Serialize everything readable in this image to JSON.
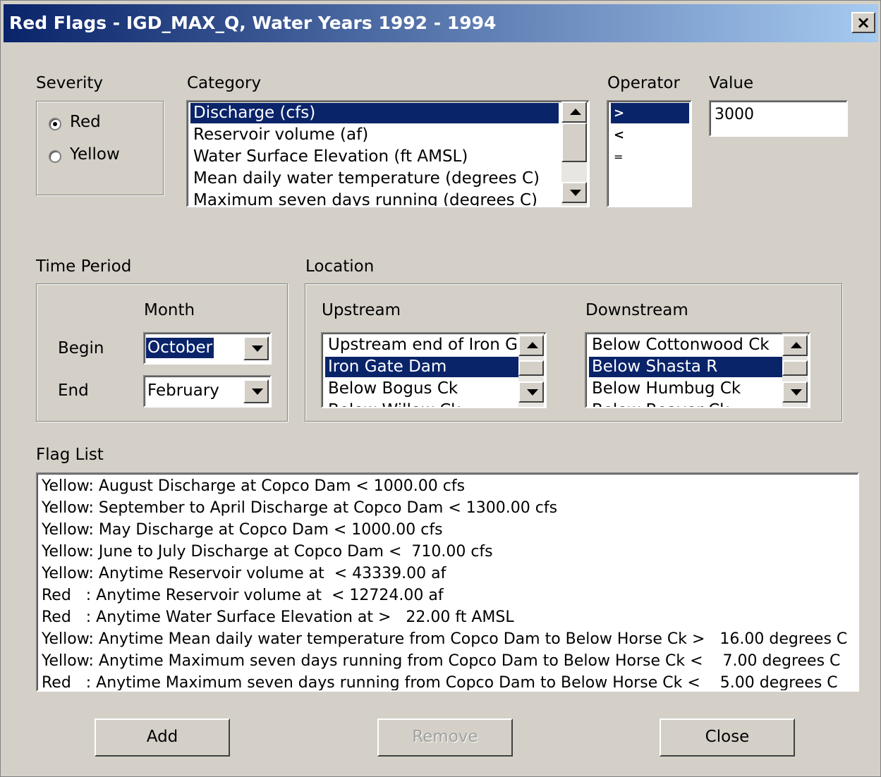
{
  "window": {
    "title": "Red Flags - IGD_MAX_Q, Water Years 1992 - 1994",
    "close_label": "×",
    "title_gradient_start": "#0a246a",
    "title_gradient_end": "#a6caf0",
    "selection_color": "#0a246a"
  },
  "severity": {
    "label": "Severity",
    "options": [
      "Red",
      "Yellow"
    ],
    "selected": "Red"
  },
  "category": {
    "label": "Category",
    "items": [
      "Discharge (cfs)",
      "Reservoir volume (af)",
      "Water Surface Elevation (ft AMSL)",
      "Mean daily water temperature (degrees C)",
      "Maximum seven days running (degrees C)"
    ],
    "selected_index": 0
  },
  "operator": {
    "label": "Operator",
    "items": [
      ">",
      "<",
      "="
    ],
    "selected_index": 0
  },
  "value": {
    "label": "Value",
    "text": "3000"
  },
  "time_period": {
    "label": "Time Period",
    "month_label": "Month",
    "begin_label": "Begin",
    "end_label": "End",
    "begin_value": "October",
    "end_value": "February"
  },
  "location": {
    "label": "Location",
    "upstream": {
      "label": "Upstream",
      "items": [
        "Upstream end of Iron Ga",
        "Iron Gate Dam",
        "Below Bogus Ck",
        "Below Willow Ck"
      ],
      "selected_index": 1
    },
    "downstream": {
      "label": "Downstream",
      "items": [
        "Below Cottonwood Ck",
        "Below Shasta R",
        "Below Humbug Ck",
        "Below Beaver Ck"
      ],
      "selected_index": 1
    }
  },
  "flag_list": {
    "label": "Flag List",
    "rows": [
      "Yellow: August Discharge at Copco Dam < 1000.00 cfs",
      "Yellow: September to April Discharge at Copco Dam < 1300.00 cfs",
      "Yellow: May Discharge at Copco Dam < 1000.00 cfs",
      "Yellow: June to July Discharge at Copco Dam <  710.00 cfs",
      "Yellow: Anytime Reservoir volume at  < 43339.00 af",
      "Red   : Anytime Reservoir volume at  < 12724.00 af",
      "Red   : Anytime Water Surface Elevation at >   22.00 ft AMSL",
      "Yellow: Anytime Mean daily water temperature from Copco Dam to Below Horse Ck >   16.00 degrees C",
      "Yellow: Anytime Maximum seven days running from Copco Dam to Below Horse Ck <    7.00 degrees C",
      "Red   : Anytime Maximum seven days running from Copco Dam to Below Horse Ck <    5.00 degrees C"
    ]
  },
  "buttons": {
    "add": "Add",
    "remove": "Remove",
    "close": "Close"
  }
}
